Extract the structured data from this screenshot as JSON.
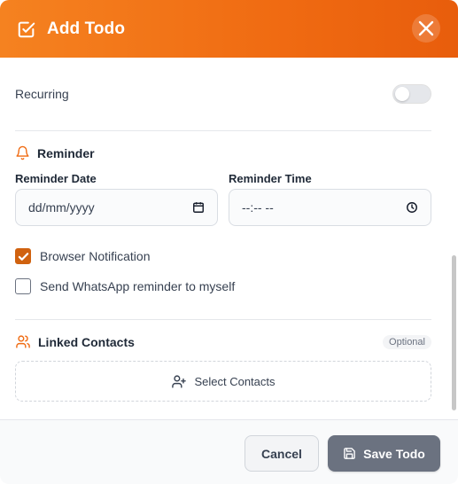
{
  "header": {
    "title": "Add Todo",
    "icon": "checkbox-edit-icon",
    "close_icon": "close-icon",
    "background": "#f06b12"
  },
  "recurring": {
    "label": "Recurring",
    "enabled": false
  },
  "reminder": {
    "title": "Reminder",
    "icon": "bell-icon",
    "date_label": "Reminder Date",
    "date_value": "dd/mm/yyyy",
    "time_label": "Reminder Time",
    "time_value": "--:-- --"
  },
  "options": {
    "browser_notification": {
      "label": "Browser Notification",
      "checked": true
    },
    "whatsapp_reminder": {
      "label": "Send WhatsApp reminder to myself",
      "checked": false
    }
  },
  "linked_contacts": {
    "title": "Linked Contacts",
    "icon": "users-icon",
    "badge": "Optional",
    "select_label": "Select Contacts",
    "select_icon": "user-plus-icon"
  },
  "footer": {
    "cancel_label": "Cancel",
    "save_label": "Save Todo",
    "save_icon": "save-icon"
  },
  "colors": {
    "accent": "#f06b12",
    "checkbox_checked": "#d0620f",
    "save_button": "#6b7280"
  }
}
